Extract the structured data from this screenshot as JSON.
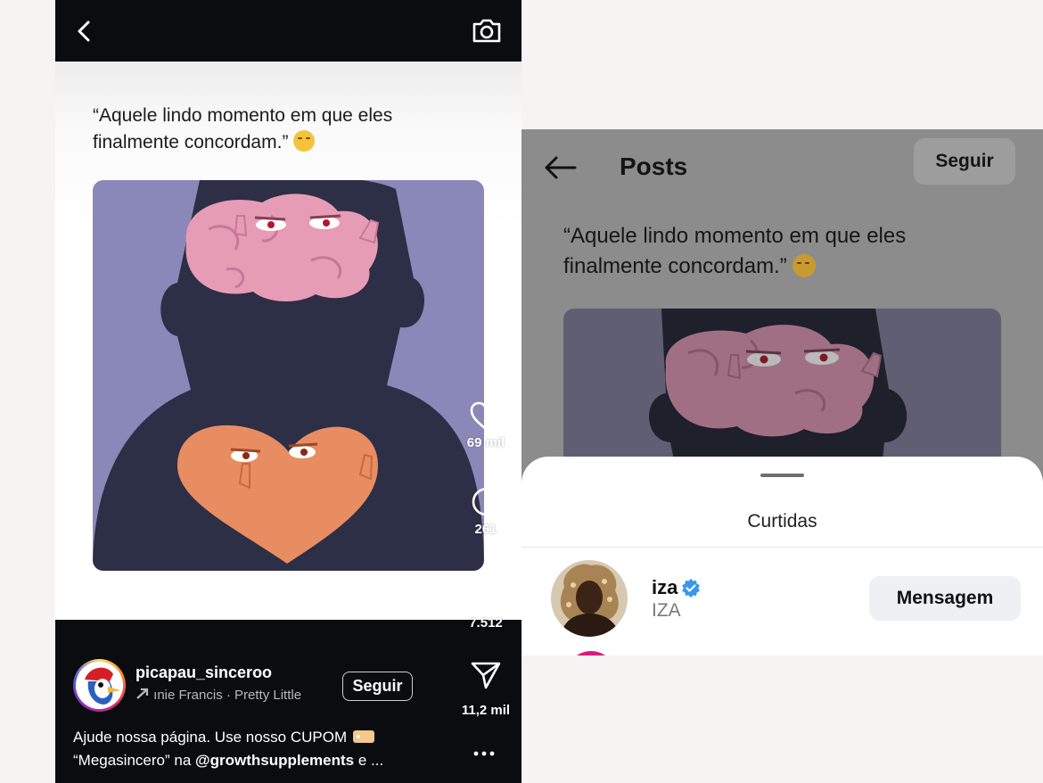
{
  "reel": {
    "quote": "“Aquele lindo momento em que eles finalmente concordam.”",
    "quote_line1": "“Aquele lindo momento em que eles",
    "quote_line2": "finalmente concordam.”",
    "likes": "69 mil",
    "comments": "261",
    "reposts": "7.512",
    "shares": "11,2 mil",
    "username": "picapau_sinceroo",
    "music": "ınie Francis · Pretty Little",
    "follow_label": "Seguir",
    "caption_line1": "Ajude nossa página. Use nosso CUPOM",
    "caption_line2_pre": "“Megasincero” na ",
    "caption_mention": "@growthsupplements",
    "caption_line2_post": " e ...",
    "icons": [
      "back-icon",
      "camera-icon",
      "heart-icon",
      "comment-icon",
      "repost-icon",
      "send-icon",
      "more-icon"
    ]
  },
  "likes_panel": {
    "title": "Posts",
    "follow_label": "Seguir",
    "quote_line1": "“Aquele lindo momento em que eles",
    "quote_line2": "finalmente concordam.”",
    "sheet_title": "Curtidas",
    "user": {
      "username": "iza",
      "full_name": "IZA",
      "verified": true,
      "button_label": "Mensagem"
    }
  },
  "colors": {
    "dark_bar": "#0a0c10",
    "dim_overlay": "#8c8c8c",
    "verified_blue": "#3897f0",
    "art_background": "#8583b3",
    "brain_pink": "#e79cb6",
    "heart_orange": "#e88c62"
  }
}
